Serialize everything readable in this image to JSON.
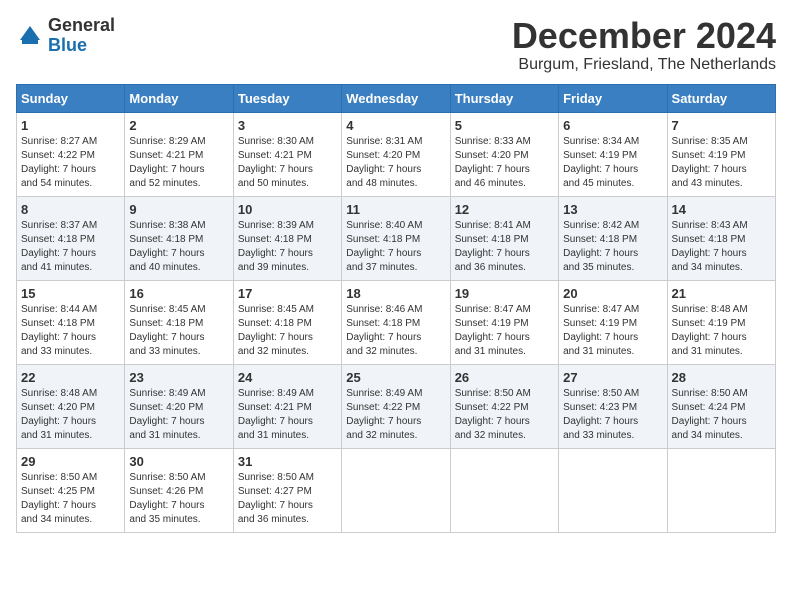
{
  "header": {
    "logo": {
      "line1": "General",
      "line2": "Blue"
    },
    "title": "December 2024",
    "location": "Burgum, Friesland, The Netherlands"
  },
  "days_of_week": [
    "Sunday",
    "Monday",
    "Tuesday",
    "Wednesday",
    "Thursday",
    "Friday",
    "Saturday"
  ],
  "weeks": [
    [
      {
        "day": "1",
        "sunrise": "8:27 AM",
        "sunset": "4:22 PM",
        "daylight_hours": "7",
        "daylight_minutes": "54"
      },
      {
        "day": "2",
        "sunrise": "8:29 AM",
        "sunset": "4:21 PM",
        "daylight_hours": "7",
        "daylight_minutes": "52"
      },
      {
        "day": "3",
        "sunrise": "8:30 AM",
        "sunset": "4:21 PM",
        "daylight_hours": "7",
        "daylight_minutes": "50"
      },
      {
        "day": "4",
        "sunrise": "8:31 AM",
        "sunset": "4:20 PM",
        "daylight_hours": "7",
        "daylight_minutes": "48"
      },
      {
        "day": "5",
        "sunrise": "8:33 AM",
        "sunset": "4:20 PM",
        "daylight_hours": "7",
        "daylight_minutes": "46"
      },
      {
        "day": "6",
        "sunrise": "8:34 AM",
        "sunset": "4:19 PM",
        "daylight_hours": "7",
        "daylight_minutes": "45"
      },
      {
        "day": "7",
        "sunrise": "8:35 AM",
        "sunset": "4:19 PM",
        "daylight_hours": "7",
        "daylight_minutes": "43"
      }
    ],
    [
      {
        "day": "8",
        "sunrise": "8:37 AM",
        "sunset": "4:18 PM",
        "daylight_hours": "7",
        "daylight_minutes": "41"
      },
      {
        "day": "9",
        "sunrise": "8:38 AM",
        "sunset": "4:18 PM",
        "daylight_hours": "7",
        "daylight_minutes": "40"
      },
      {
        "day": "10",
        "sunrise": "8:39 AM",
        "sunset": "4:18 PM",
        "daylight_hours": "7",
        "daylight_minutes": "39"
      },
      {
        "day": "11",
        "sunrise": "8:40 AM",
        "sunset": "4:18 PM",
        "daylight_hours": "7",
        "daylight_minutes": "37"
      },
      {
        "day": "12",
        "sunrise": "8:41 AM",
        "sunset": "4:18 PM",
        "daylight_hours": "7",
        "daylight_minutes": "36"
      },
      {
        "day": "13",
        "sunrise": "8:42 AM",
        "sunset": "4:18 PM",
        "daylight_hours": "7",
        "daylight_minutes": "35"
      },
      {
        "day": "14",
        "sunrise": "8:43 AM",
        "sunset": "4:18 PM",
        "daylight_hours": "7",
        "daylight_minutes": "34"
      }
    ],
    [
      {
        "day": "15",
        "sunrise": "8:44 AM",
        "sunset": "4:18 PM",
        "daylight_hours": "7",
        "daylight_minutes": "33"
      },
      {
        "day": "16",
        "sunrise": "8:45 AM",
        "sunset": "4:18 PM",
        "daylight_hours": "7",
        "daylight_minutes": "33"
      },
      {
        "day": "17",
        "sunrise": "8:45 AM",
        "sunset": "4:18 PM",
        "daylight_hours": "7",
        "daylight_minutes": "32"
      },
      {
        "day": "18",
        "sunrise": "8:46 AM",
        "sunset": "4:18 PM",
        "daylight_hours": "7",
        "daylight_minutes": "32"
      },
      {
        "day": "19",
        "sunrise": "8:47 AM",
        "sunset": "4:19 PM",
        "daylight_hours": "7",
        "daylight_minutes": "31"
      },
      {
        "day": "20",
        "sunrise": "8:47 AM",
        "sunset": "4:19 PM",
        "daylight_hours": "7",
        "daylight_minutes": "31"
      },
      {
        "day": "21",
        "sunrise": "8:48 AM",
        "sunset": "4:19 PM",
        "daylight_hours": "7",
        "daylight_minutes": "31"
      }
    ],
    [
      {
        "day": "22",
        "sunrise": "8:48 AM",
        "sunset": "4:20 PM",
        "daylight_hours": "7",
        "daylight_minutes": "31"
      },
      {
        "day": "23",
        "sunrise": "8:49 AM",
        "sunset": "4:20 PM",
        "daylight_hours": "7",
        "daylight_minutes": "31"
      },
      {
        "day": "24",
        "sunrise": "8:49 AM",
        "sunset": "4:21 PM",
        "daylight_hours": "7",
        "daylight_minutes": "31"
      },
      {
        "day": "25",
        "sunrise": "8:49 AM",
        "sunset": "4:22 PM",
        "daylight_hours": "7",
        "daylight_minutes": "32"
      },
      {
        "day": "26",
        "sunrise": "8:50 AM",
        "sunset": "4:22 PM",
        "daylight_hours": "7",
        "daylight_minutes": "32"
      },
      {
        "day": "27",
        "sunrise": "8:50 AM",
        "sunset": "4:23 PM",
        "daylight_hours": "7",
        "daylight_minutes": "33"
      },
      {
        "day": "28",
        "sunrise": "8:50 AM",
        "sunset": "4:24 PM",
        "daylight_hours": "7",
        "daylight_minutes": "34"
      }
    ],
    [
      {
        "day": "29",
        "sunrise": "8:50 AM",
        "sunset": "4:25 PM",
        "daylight_hours": "7",
        "daylight_minutes": "34"
      },
      {
        "day": "30",
        "sunrise": "8:50 AM",
        "sunset": "4:26 PM",
        "daylight_hours": "7",
        "daylight_minutes": "35"
      },
      {
        "day": "31",
        "sunrise": "8:50 AM",
        "sunset": "4:27 PM",
        "daylight_hours": "7",
        "daylight_minutes": "36"
      },
      null,
      null,
      null,
      null
    ]
  ]
}
